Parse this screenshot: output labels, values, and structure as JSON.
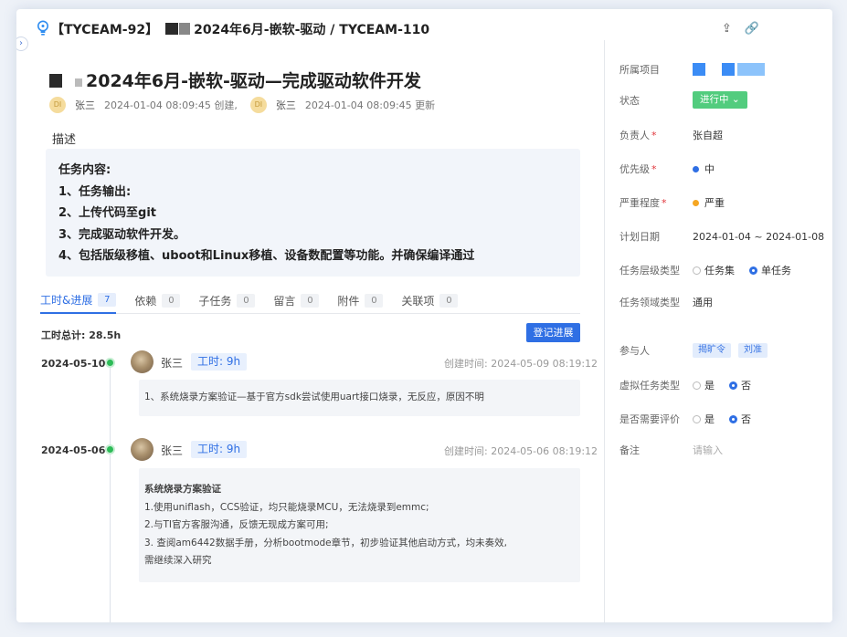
{
  "header": {
    "key": "【TYCEAM-92】",
    "path": "2024年6月-嵌软-驱动 / TYCEAM-110",
    "tool_icons": [
      "share-icon",
      "link-icon"
    ]
  },
  "task": {
    "title": "2024年6月-嵌软-驱动—完成驱动软件开发",
    "creator_avatar": "DI",
    "creator": "张三",
    "created": "2024-01-04 08:09:45 创建,",
    "updater_avatar": "DI",
    "updater": "张三",
    "updated": "2024-01-04 08:09:45 更新",
    "desc_label": "描述",
    "desc_lines": [
      "任务内容:",
      "1、任务输出:",
      "2、上传代码至git",
      "3、完成驱动软件开发。",
      "4、包括版级移植、uboot和Linux移植、设备数配置等功能。并确保编译通过"
    ]
  },
  "tabs": [
    {
      "label": "工时&进展",
      "count": "7"
    },
    {
      "label": "依赖",
      "count": "0"
    },
    {
      "label": "子任务",
      "count": "0"
    },
    {
      "label": "留言",
      "count": "0"
    },
    {
      "label": "附件",
      "count": "0"
    },
    {
      "label": "关联项",
      "count": "0"
    }
  ],
  "worklog": {
    "total": "工时总计: 28.5h",
    "register_button": "登记进展",
    "entries": [
      {
        "date": "2024-05-10",
        "name": "张三",
        "hours": "工时: 9h",
        "created": "创建时间: 2024-05-09 08:19:12",
        "lines": [
          "1、系统烧录方案验证—基于官方sdk尝试使用uart接口烧录，无反应，原因不明"
        ]
      },
      {
        "date": "2024-05-06",
        "name": "张三",
        "hours": "工时: 9h",
        "created": "创建时间: 2024-05-06 08:19:12",
        "lines": [
          "系统烧录方案验证",
          "1.使用uniflash，CCS验证，均只能烧录MCU，无法烧录到emmc;",
          "2.与TI官方客服沟通，反馈无现成方案可用;",
          "3. 查阅am6442数据手册，分析bootmode章节，初步验证其他启动方式，均未奏效,",
          "需继续深入研究"
        ]
      }
    ]
  },
  "sidebar": {
    "project_label": "所属项目",
    "status_label": "状态",
    "status_value": "进行中",
    "owner_label": "负责人",
    "owner_value": "张自超",
    "priority_label": "优先级",
    "priority_value": "中",
    "severity_label": "严重程度",
    "severity_value": "严重",
    "plan_label": "计划日期",
    "plan_value": "2024-01-04 ~ 2024-01-08",
    "level_label": "任务层级类型",
    "level_opt1": "任务集",
    "level_opt2": "单任务",
    "domain_label": "任务领域类型",
    "domain_value": "通用",
    "participants_label": "参与人",
    "participant1": "揭旷令",
    "participant2": "刘准",
    "virtual_label": "虚拟任务类型",
    "virtual_yes": "是",
    "virtual_no": "否",
    "review_label": "是否需要评价",
    "review_yes": "是",
    "review_no": "否",
    "remark_label": "备注",
    "remark_placeholder": "请输入"
  },
  "colors": {
    "accent": "#2f6fe4",
    "status_green": "#52cc7e",
    "timeline_dot": "#2dbb57",
    "priority_dot": "#2f6fe4",
    "severity_dot": "#f5a623"
  }
}
